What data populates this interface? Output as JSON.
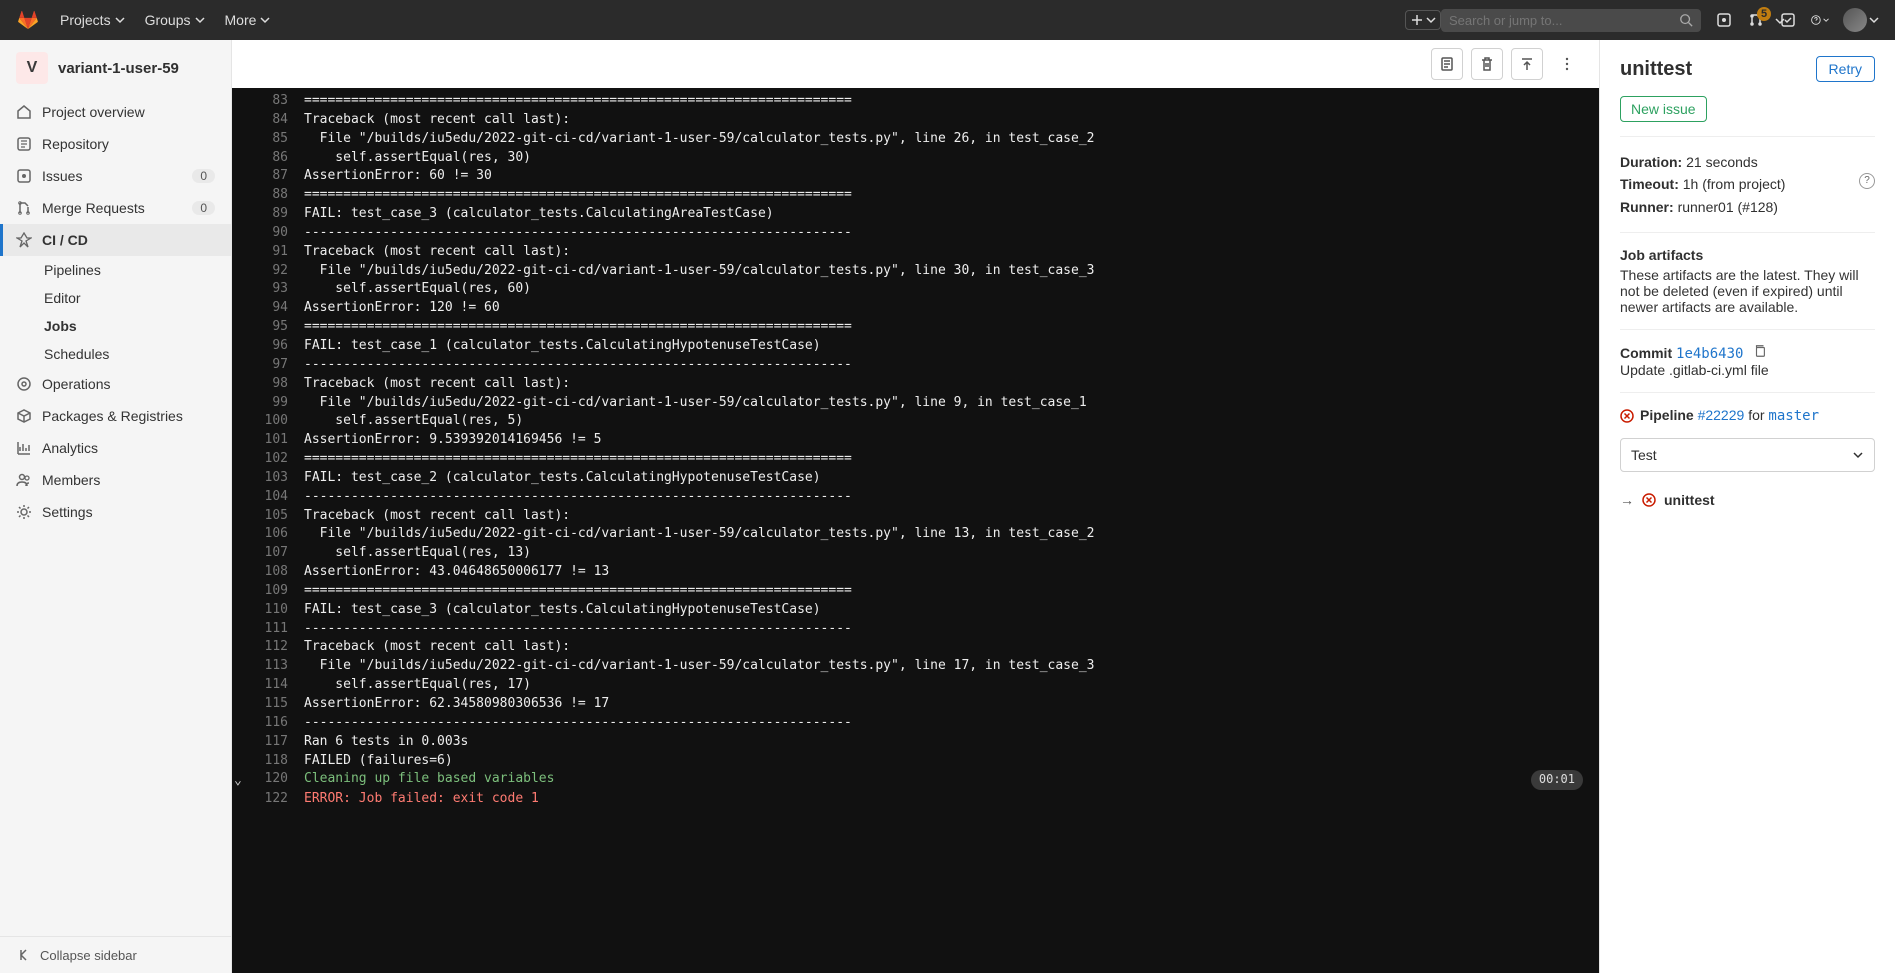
{
  "topbar": {
    "nav": [
      "Projects",
      "Groups",
      "More"
    ],
    "search_placeholder": "Search or jump to...",
    "mr_badge": "5"
  },
  "project": {
    "initial": "V",
    "name": "variant-1-user-59"
  },
  "sidebar": {
    "items": [
      {
        "label": "Project overview"
      },
      {
        "label": "Repository"
      },
      {
        "label": "Issues",
        "badge": "0"
      },
      {
        "label": "Merge Requests",
        "badge": "0"
      },
      {
        "label": "CI / CD",
        "active": true
      },
      {
        "label": "Operations"
      },
      {
        "label": "Packages & Registries"
      },
      {
        "label": "Analytics"
      },
      {
        "label": "Members"
      },
      {
        "label": "Settings"
      }
    ],
    "submenu": [
      "Pipelines",
      "Editor",
      "Jobs",
      "Schedules"
    ],
    "collapse": "Collapse sidebar"
  },
  "log_lines": [
    {
      "n": 83,
      "t": "======================================================================"
    },
    {
      "n": 84,
      "t": "Traceback (most recent call last):"
    },
    {
      "n": 85,
      "t": "  File \"/builds/iu5edu/2022-git-ci-cd/variant-1-user-59/calculator_tests.py\", line 26, in test_case_2"
    },
    {
      "n": 86,
      "t": "    self.assertEqual(res, 30)"
    },
    {
      "n": 87,
      "t": "AssertionError: 60 != 30"
    },
    {
      "n": 88,
      "t": "======================================================================"
    },
    {
      "n": 89,
      "t": "FAIL: test_case_3 (calculator_tests.CalculatingAreaTestCase)"
    },
    {
      "n": 90,
      "t": "----------------------------------------------------------------------"
    },
    {
      "n": 91,
      "t": "Traceback (most recent call last):"
    },
    {
      "n": 92,
      "t": "  File \"/builds/iu5edu/2022-git-ci-cd/variant-1-user-59/calculator_tests.py\", line 30, in test_case_3"
    },
    {
      "n": 93,
      "t": "    self.assertEqual(res, 60)"
    },
    {
      "n": 94,
      "t": "AssertionError: 120 != 60"
    },
    {
      "n": 95,
      "t": "======================================================================"
    },
    {
      "n": 96,
      "t": "FAIL: test_case_1 (calculator_tests.CalculatingHypotenuseTestCase)"
    },
    {
      "n": 97,
      "t": "----------------------------------------------------------------------"
    },
    {
      "n": 98,
      "t": "Traceback (most recent call last):"
    },
    {
      "n": 99,
      "t": "  File \"/builds/iu5edu/2022-git-ci-cd/variant-1-user-59/calculator_tests.py\", line 9, in test_case_1"
    },
    {
      "n": 100,
      "t": "    self.assertEqual(res, 5)"
    },
    {
      "n": 101,
      "t": "AssertionError: 9.539392014169456 != 5"
    },
    {
      "n": 102,
      "t": "======================================================================"
    },
    {
      "n": 103,
      "t": "FAIL: test_case_2 (calculator_tests.CalculatingHypotenuseTestCase)"
    },
    {
      "n": 104,
      "t": "----------------------------------------------------------------------"
    },
    {
      "n": 105,
      "t": "Traceback (most recent call last):"
    },
    {
      "n": 106,
      "t": "  File \"/builds/iu5edu/2022-git-ci-cd/variant-1-user-59/calculator_tests.py\", line 13, in test_case_2"
    },
    {
      "n": 107,
      "t": "    self.assertEqual(res, 13)"
    },
    {
      "n": 108,
      "t": "AssertionError: 43.04648650006177 != 13"
    },
    {
      "n": 109,
      "t": "======================================================================"
    },
    {
      "n": 110,
      "t": "FAIL: test_case_3 (calculator_tests.CalculatingHypotenuseTestCase)"
    },
    {
      "n": 111,
      "t": "----------------------------------------------------------------------"
    },
    {
      "n": 112,
      "t": "Traceback (most recent call last):"
    },
    {
      "n": 113,
      "t": "  File \"/builds/iu5edu/2022-git-ci-cd/variant-1-user-59/calculator_tests.py\", line 17, in test_case_3"
    },
    {
      "n": 114,
      "t": "    self.assertEqual(res, 17)"
    },
    {
      "n": 115,
      "t": "AssertionError: 62.34580980306536 != 17"
    },
    {
      "n": 116,
      "t": "----------------------------------------------------------------------"
    },
    {
      "n": 117,
      "t": "Ran 6 tests in 0.003s"
    },
    {
      "n": 118,
      "t": "FAILED (failures=6)"
    },
    {
      "n": 120,
      "t": "Cleaning up file based variables",
      "cls": "green",
      "chev": true,
      "time": "00:01"
    },
    {
      "n": 122,
      "t": "ERROR: Job failed: exit code 1",
      "cls": "red"
    }
  ],
  "details": {
    "title": "unittest",
    "retry": "Retry",
    "new_issue": "New issue",
    "duration_label": "Duration:",
    "duration": "21 seconds",
    "timeout_label": "Timeout:",
    "timeout": "1h (from project)",
    "runner_label": "Runner:",
    "runner": "runner01 (#128)",
    "artifacts_head": "Job artifacts",
    "artifacts_desc": "These artifacts are the latest. They will not be deleted (even if expired) until newer artifacts are available.",
    "commit_label": "Commit",
    "commit_hash": "1e4b6430",
    "commit_msg": "Update .gitlab-ci.yml file",
    "pipeline_label": "Pipeline",
    "pipeline_num": "#22229",
    "pipeline_for": "for",
    "pipeline_branch": "master",
    "stage": "Test",
    "job_name": "unittest"
  }
}
